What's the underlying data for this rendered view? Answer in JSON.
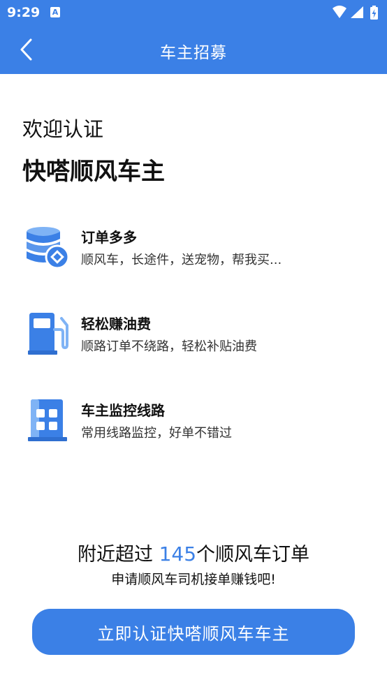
{
  "status_bar": {
    "time": "9:29",
    "notification_icon": "A",
    "icons": [
      "wifi-icon",
      "signal-icon",
      "battery-charging-icon"
    ]
  },
  "app_bar": {
    "back_icon": "chevron-left-icon",
    "title": "车主招募"
  },
  "header": {
    "welcome": "欢迎认证",
    "brand": "快嗒顺风车主"
  },
  "features": [
    {
      "icon": "database-coin-icon",
      "title": "订单多多",
      "desc": "顺风车，长途件，送宠物，帮我买..."
    },
    {
      "icon": "fuel-pump-icon",
      "title": "轻松赚油费",
      "desc": "顺路订单不绕路，轻松补贴油费"
    },
    {
      "icon": "building-grid-icon",
      "title": "车主监控线路",
      "desc": "常用线路监控，好单不错过"
    }
  ],
  "promo": {
    "prefix": "附近超过 ",
    "count": "145",
    "suffix": "个顺风车订单",
    "sub": "申请顺风车司机接单赚钱吧!"
  },
  "cta": {
    "label": "立即认证快嗒顺风车车主"
  },
  "colors": {
    "primary": "#3b80e6",
    "icon_light": "#7fb3f5",
    "text": "#111111"
  }
}
